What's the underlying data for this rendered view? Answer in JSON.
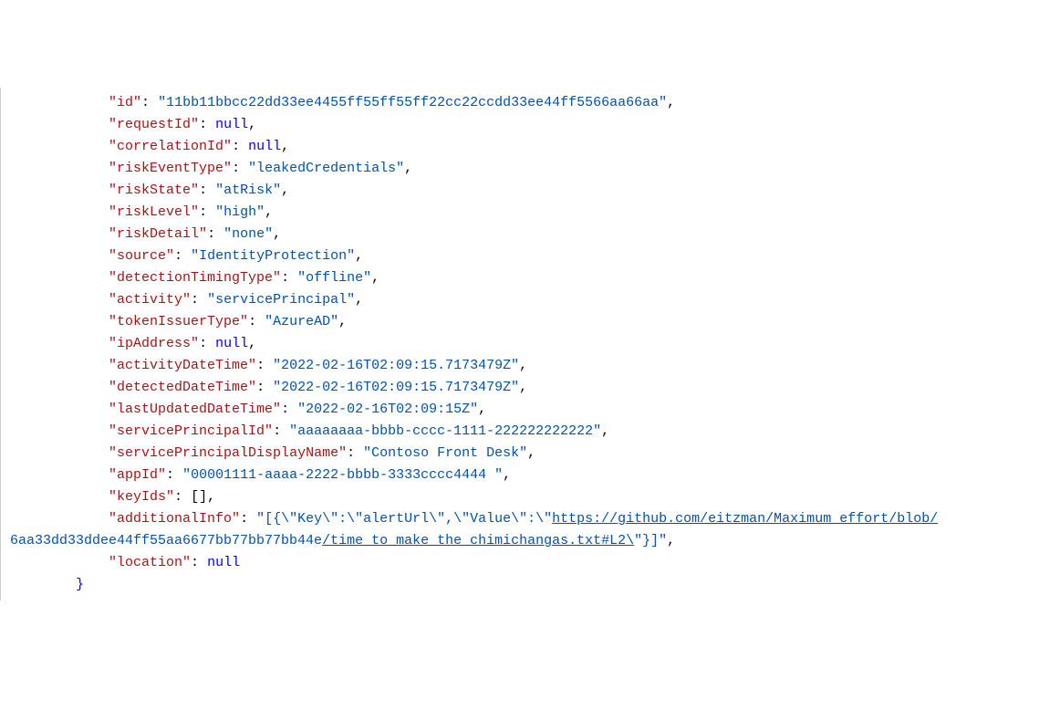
{
  "indent": "            ",
  "indent_close": "        ",
  "entries": [
    {
      "key": "id",
      "type": "string",
      "value": "11bb11bbcc22dd33ee4455ff55ff55ff22cc22ccdd33ee44ff5566aa66aa",
      "comma": true
    },
    {
      "key": "requestId",
      "type": "null",
      "value": "null",
      "comma": true
    },
    {
      "key": "correlationId",
      "type": "null",
      "value": "null",
      "comma": true
    },
    {
      "key": "riskEventType",
      "type": "string",
      "value": "leakedCredentials",
      "comma": true
    },
    {
      "key": "riskState",
      "type": "string",
      "value": "atRisk",
      "comma": true
    },
    {
      "key": "riskLevel",
      "type": "string",
      "value": "high",
      "comma": true
    },
    {
      "key": "riskDetail",
      "type": "string",
      "value": "none",
      "comma": true
    },
    {
      "key": "source",
      "type": "string",
      "value": "IdentityProtection",
      "comma": true
    },
    {
      "key": "detectionTimingType",
      "type": "string",
      "value": "offline",
      "comma": true
    },
    {
      "key": "activity",
      "type": "string",
      "value": "servicePrincipal",
      "comma": true
    },
    {
      "key": "tokenIssuerType",
      "type": "string",
      "value": "AzureAD",
      "comma": true
    },
    {
      "key": "ipAddress",
      "type": "null",
      "value": "null",
      "comma": true
    },
    {
      "key": "activityDateTime",
      "type": "string",
      "value": "2022-02-16T02:09:15.7173479Z",
      "comma": true
    },
    {
      "key": "detectedDateTime",
      "type": "string",
      "value": "2022-02-16T02:09:15.7173479Z",
      "comma": true
    },
    {
      "key": "lastUpdatedDateTime",
      "type": "string",
      "value": "2022-02-16T02:09:15Z",
      "comma": true
    },
    {
      "key": "servicePrincipalId",
      "type": "string",
      "value": "aaaaaaaa-bbbb-cccc-1111-222222222222",
      "comma": true
    },
    {
      "key": "servicePrincipalDisplayName",
      "type": "string",
      "value": "Contoso Front Desk",
      "comma": true
    },
    {
      "key": "appId",
      "type": "string",
      "value": "00001111-aaaa-2222-bbbb-3333cccc4444 ",
      "comma": true
    },
    {
      "key": "keyIds",
      "type": "array",
      "value": "[]",
      "comma": true
    },
    {
      "key": "additionalInfo",
      "type": "additionalInfo",
      "comma": true
    },
    {
      "key": "location",
      "type": "null",
      "value": "null",
      "comma": false
    }
  ],
  "additionalInfo": {
    "prefix": "[{\\\"Key\\\":\\\"alertUrl\\\",\\\"Value\\\":\\\"",
    "url_line1": "https://github.com/eitzman/Maximum_effort/blob/",
    "line2_prefix": "6aa33dd33ddee44ff55aa6677bb77bb77bb44e",
    "url_line2_suffix": "/time_to_make_the_chimichangas.txt#L2\\",
    "suffix": "\"}]"
  },
  "closing_brace": "}"
}
